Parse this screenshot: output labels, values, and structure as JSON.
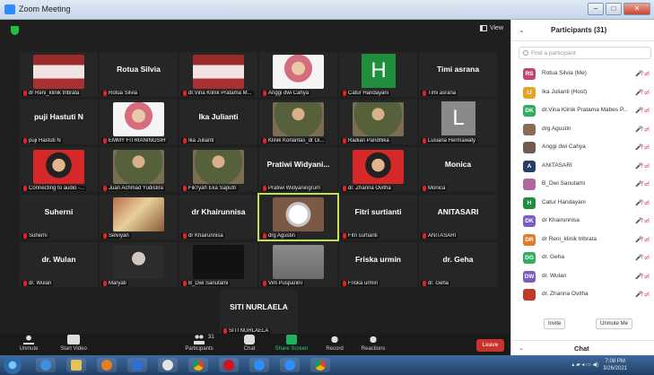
{
  "window": {
    "title": "Zoom Meeting"
  },
  "view_label": "View",
  "tiles": [
    {
      "name": "dr Reni_klinik tribrata",
      "big": "",
      "kind": "poster"
    },
    {
      "name": "Rotua Silvia",
      "big": "Rotua Silvia",
      "kind": "none"
    },
    {
      "name": "dr.Vina Klinik Pratama M...",
      "big": "",
      "kind": "poster"
    },
    {
      "name": "Anggi dwi Cahya",
      "big": "",
      "kind": "person"
    },
    {
      "name": "Catur Handayani",
      "big": "",
      "kind": "letterH"
    },
    {
      "name": "Timi asrana",
      "big": "Timi asrana",
      "kind": "none"
    },
    {
      "name": "puji Hastuti N",
      "big": "puji Hastuti N",
      "kind": "none"
    },
    {
      "name": "EMMY FITRIANINGSIH",
      "big": "",
      "kind": "person"
    },
    {
      "name": "Ika Julianti",
      "big": "Ika Julianti",
      "kind": "none"
    },
    {
      "name": "Klinik Korlantas_dr Di...",
      "big": "",
      "kind": "uniform"
    },
    {
      "name": "Radian Pandhika",
      "big": "",
      "kind": "uniform"
    },
    {
      "name": "Lusiana Hermawaty",
      "big": "",
      "kind": "letterL"
    },
    {
      "name": "Connecting to audio -...",
      "big": "",
      "kind": "redbg"
    },
    {
      "name": "Juan Achmad Yudistira",
      "big": "",
      "kind": "uniform"
    },
    {
      "name": "Fik'ryah Eka Saputri",
      "big": "",
      "kind": "uniform"
    },
    {
      "name": "Pratiwi Widyaningrum",
      "big": "Pratiwi Widyani...",
      "kind": "none"
    },
    {
      "name": "dr. Zhanna Ovitha",
      "big": "",
      "kind": "redbg"
    },
    {
      "name": "Monica",
      "big": "Monica",
      "kind": "none"
    },
    {
      "name": "Suherni",
      "big": "Suherni",
      "kind": "none"
    },
    {
      "name": "Selviyan",
      "big": "",
      "kind": "group"
    },
    {
      "name": "dr Khairunnisa",
      "big": "dr Khairunnisa",
      "kind": "none"
    },
    {
      "name": "drg Agustin",
      "big": "",
      "kind": "ring"
    },
    {
      "name": "Fitri surtianti",
      "big": "Fitri surtianti",
      "kind": "none"
    },
    {
      "name": "ANITASARI",
      "big": "ANITASARI",
      "kind": "none"
    },
    {
      "name": "dr. Wulan",
      "big": "dr. Wulan",
      "kind": "none"
    },
    {
      "name": "Maryati",
      "big": "",
      "kind": "balloon"
    },
    {
      "name": "B_Dwi Sanutami",
      "big": "",
      "kind": "pink"
    },
    {
      "name": "Virli Puspariini",
      "big": "",
      "kind": "grey"
    },
    {
      "name": "Friska urmin",
      "big": "Friska urmin",
      "kind": "none"
    },
    {
      "name": "dr. Geha",
      "big": "dr. Geha",
      "kind": "none"
    },
    {
      "name": "SITI NURLAELA",
      "big": "SITI NURLAELA",
      "kind": "none"
    }
  ],
  "toolbar": {
    "unmute": "Unmute",
    "start_video": "Start Video",
    "participants": "Participants",
    "participants_count": "31",
    "chat": "Chat",
    "share_screen": "Share Screen",
    "record": "Record",
    "reactions": "Reactions",
    "leave": "Leave"
  },
  "panel": {
    "title": "Participants (31)",
    "search_placeholder": "Find a participant",
    "invite": "Invite",
    "unmute_me": "Unmute Me",
    "chat_title": "Chat",
    "participants": [
      {
        "initials": "RS",
        "color": "#c2456f",
        "name": "Rotua Silvia (Me)"
      },
      {
        "initials": "IJ",
        "color": "#e7a126",
        "name": "Ika Julianti (Host)"
      },
      {
        "initials": "DK",
        "color": "#2fae62",
        "name": "dr.Vina Klinik Pratama Mabes P..."
      },
      {
        "initials": "",
        "color": "#8b6a57",
        "name": "drg Agustin"
      },
      {
        "initials": "",
        "color": "#6f5b4f",
        "name": "Anggi dwi Cahya"
      },
      {
        "initials": "A",
        "color": "#283e66",
        "name": "ANITASARI"
      },
      {
        "initials": "",
        "color": "#b0689f",
        "name": "B_Dwi Sanutami"
      },
      {
        "initials": "H",
        "color": "#1f8f3d",
        "name": "Catur Handayani"
      },
      {
        "initials": "DK",
        "color": "#7b5cc4",
        "name": "dr Khairunnisa"
      },
      {
        "initials": "DR",
        "color": "#e07b2a",
        "name": "dr Reni_klinik tribrata"
      },
      {
        "initials": "DG",
        "color": "#2fae62",
        "name": "dr. Geha"
      },
      {
        "initials": "DW",
        "color": "#7b5cc4",
        "name": "dr. Wulan"
      },
      {
        "initials": "",
        "color": "#c0392b",
        "name": "dr. Zhanna Ovitha"
      }
    ]
  },
  "taskbar": {
    "time": "7:08 PM",
    "date": "3/26/2021"
  }
}
